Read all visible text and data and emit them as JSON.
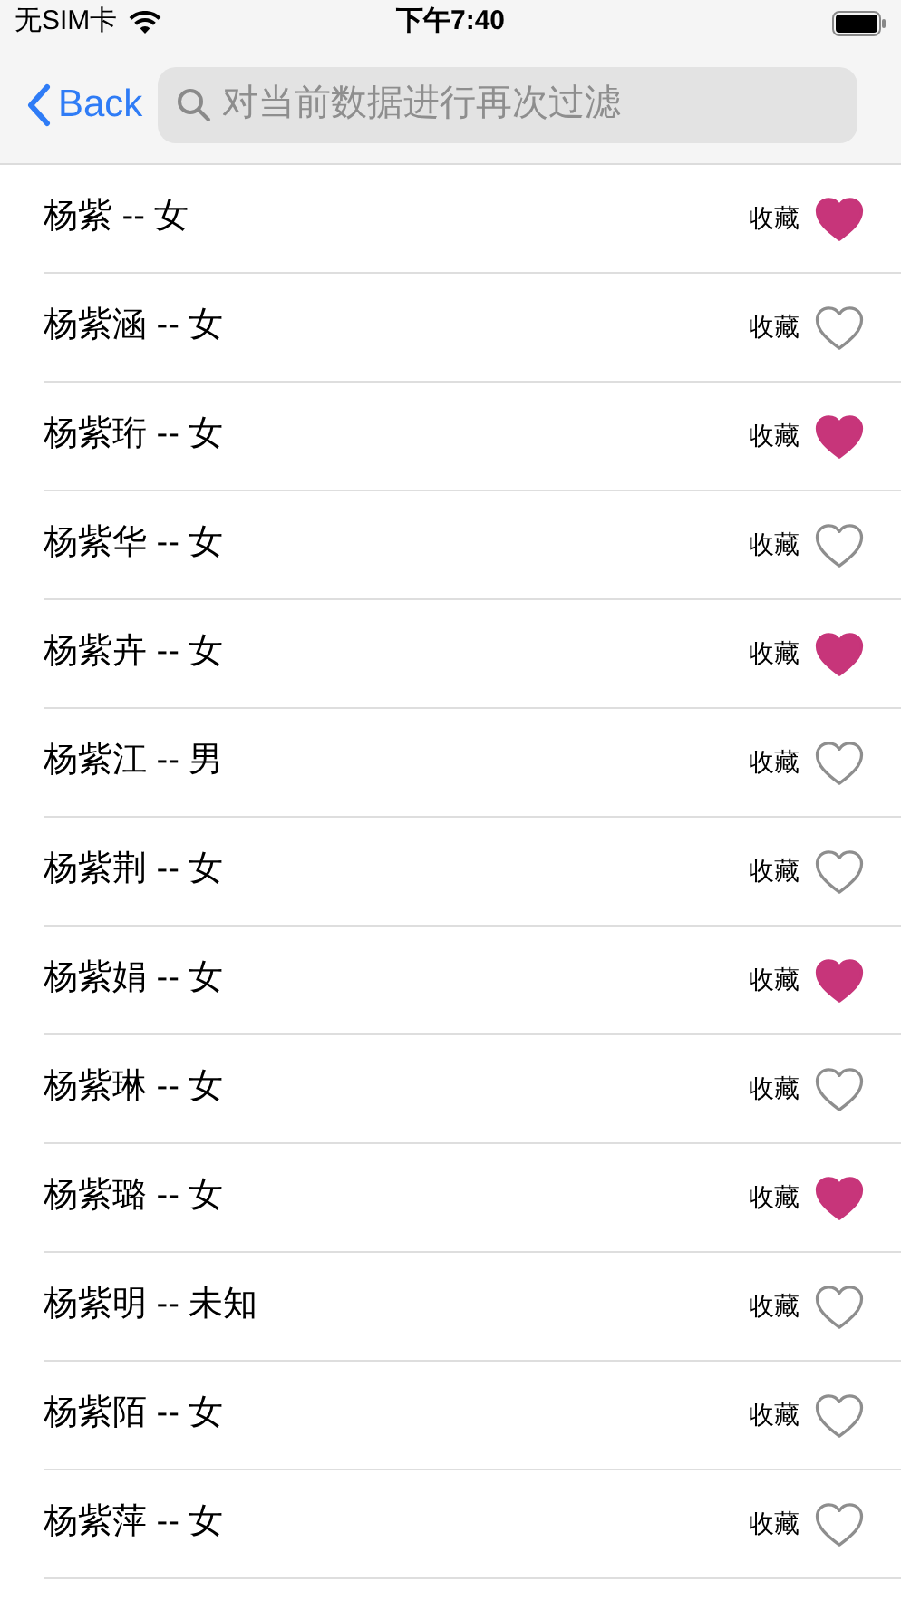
{
  "status_bar": {
    "carrier": "无SIM卡",
    "time": "下午7:40"
  },
  "nav": {
    "back": "Back",
    "search": {
      "placeholder": "对当前数据进行再次过滤"
    }
  },
  "rows": [
    {
      "title": "杨紫 -- 女",
      "action": "收藏",
      "favorite": true
    },
    {
      "title": "杨紫涵 -- 女",
      "action": "收藏",
      "favorite": false
    },
    {
      "title": "杨紫珩 -- 女",
      "action": "收藏",
      "favorite": true
    },
    {
      "title": "杨紫华 -- 女",
      "action": "收藏",
      "favorite": false
    },
    {
      "title": "杨紫卉 -- 女",
      "action": "收藏",
      "favorite": true
    },
    {
      "title": "杨紫江 -- 男",
      "action": "收藏",
      "favorite": false
    },
    {
      "title": "杨紫荆 -- 女",
      "action": "收藏",
      "favorite": false
    },
    {
      "title": "杨紫娟 -- 女",
      "action": "收藏",
      "favorite": true
    },
    {
      "title": "杨紫琳 -- 女",
      "action": "收藏",
      "favorite": false
    },
    {
      "title": "杨紫璐 -- 女",
      "action": "收藏",
      "favorite": true
    },
    {
      "title": "杨紫明 -- 未知",
      "action": "收藏",
      "favorite": false
    },
    {
      "title": "杨紫陌 -- 女",
      "action": "收藏",
      "favorite": false
    },
    {
      "title": "杨紫萍 -- 女",
      "action": "收藏",
      "favorite": false
    }
  ]
}
